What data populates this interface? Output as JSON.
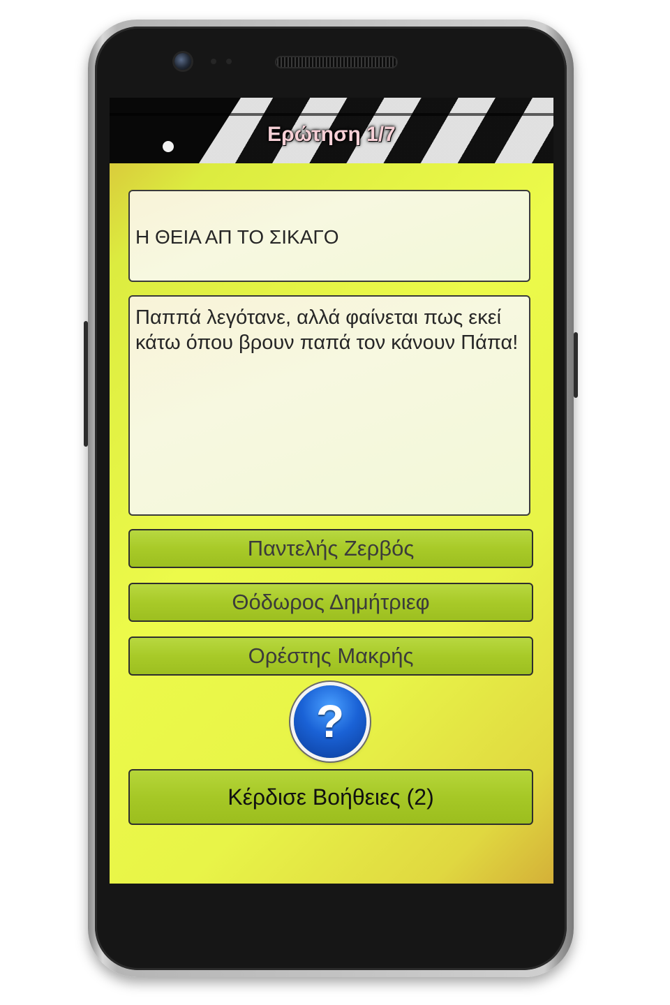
{
  "header": {
    "title": "Ερώτηση 1/7"
  },
  "question": {
    "movie_title": "Η ΘΕΙΑ ΑΠ ΤΟ ΣΙΚΑΓΟ",
    "quote": "Παππά λεγότανε, αλλά φαίνεται πως εκεί κάτω όπου βρουν παπά τον κάνουν Πάπα!"
  },
  "answers": [
    {
      "label": "Παντελής Ζερβός"
    },
    {
      "label": "Θόδωρος Δημήτριεφ"
    },
    {
      "label": "Ορέστης Μακρής"
    }
  ],
  "help": {
    "icon": "question-mark-icon",
    "symbol": "?"
  },
  "bonus_button": {
    "label": "Κέρδισε Βοήθειες (2)"
  },
  "colors": {
    "answer_green": "#a8ca28",
    "background_yellow": "#ecfa4a",
    "help_blue": "#1a62d6",
    "title_pink": "#f6d0d6"
  }
}
